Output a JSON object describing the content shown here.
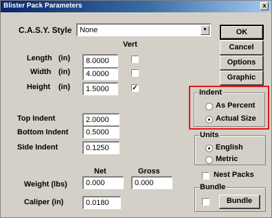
{
  "window": {
    "title": "Blister Pack Parameters",
    "close_glyph": "x"
  },
  "casy": {
    "label": "C.A.S.Y. Style",
    "value": "None"
  },
  "columns": {
    "vert": "Vert",
    "net": "Net",
    "gross": "Gross"
  },
  "length": {
    "label": "Length",
    "unit": "(in)",
    "value": "8.0000",
    "vert_checked": false
  },
  "width": {
    "label": "Width",
    "unit": "(in)",
    "value": "4.0000",
    "vert_checked": false
  },
  "height": {
    "label": "Height",
    "unit": "(in)",
    "value": "1.5000",
    "vert_checked": true,
    "check_glyph": "✓"
  },
  "top_indent": {
    "label": "Top Indent",
    "value": "2.0000"
  },
  "bottom_indent": {
    "label": "Bottom Indent",
    "value": "0.5000"
  },
  "side_indent": {
    "label": "Side Indent",
    "value": "0.1250"
  },
  "weight": {
    "label": "Weight  (lbs)",
    "net": "0.000",
    "gross": "0.000"
  },
  "caliper": {
    "label": "Caliper  (in)",
    "value": "0.0180"
  },
  "buttons": {
    "ok": "OK",
    "cancel": "Cancel",
    "options": "Options",
    "graphic": "Graphic"
  },
  "indent_group": {
    "title": "Indent",
    "as_percent": "As Percent",
    "actual_size": "Actual Size",
    "selected": "actual_size",
    "highlight_color": "#e01818"
  },
  "units_group": {
    "title": "Units",
    "english": "English",
    "metric": "Metric",
    "selected": "english"
  },
  "nest_packs": {
    "label": "Nest Packs",
    "checked": false
  },
  "bundle_group": {
    "title": "Bundle",
    "button": "Bundle",
    "checked": false
  }
}
